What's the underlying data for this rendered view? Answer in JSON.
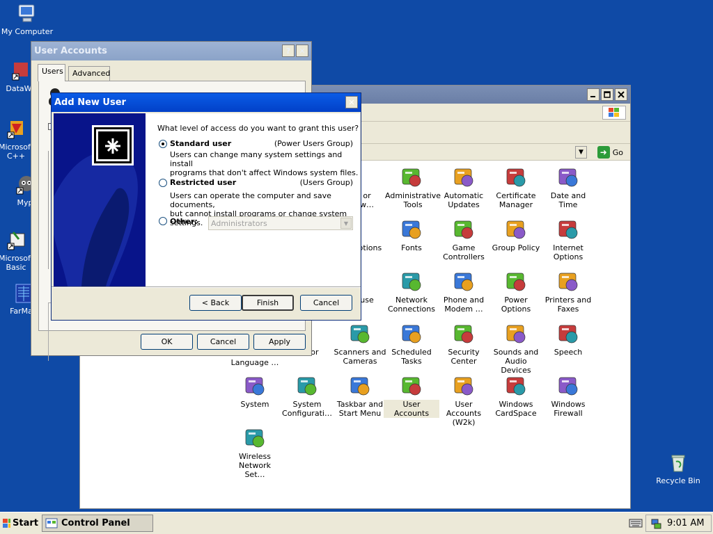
{
  "desktop": {
    "icons": [
      {
        "label": "My Computer",
        "icon": "computer-icon"
      },
      {
        "label": "DataWa",
        "icon": "datawatch-icon"
      },
      {
        "label": "Microsoft C++",
        "icon": "cpp-icon"
      },
      {
        "label": "Myp",
        "icon": "raccoon-icon"
      },
      {
        "label": "Microsoft Basic",
        "icon": "basic-icon"
      },
      {
        "label": "FarMan",
        "icon": "far-manager-icon"
      },
      {
        "label": "Recycle Bin",
        "icon": "recycle-bin-icon"
      }
    ]
  },
  "control_panel": {
    "go_label": "Go",
    "items": [
      {
        "label": "or\nw…",
        "icon": "accessibility-icon"
      },
      {
        "label": "Administrative\nTools",
        "icon": "admin-tools-icon"
      },
      {
        "label": "Automatic\nUpdates",
        "icon": "windows-update-icon"
      },
      {
        "label": "Certificate\nManager",
        "icon": "certificate-icon"
      },
      {
        "label": "Date and Time",
        "icon": "clock-icon"
      },
      {
        "label": "Options",
        "icon": "folder-options-icon"
      },
      {
        "label": "Fonts",
        "icon": "fonts-folder-icon"
      },
      {
        "label": "Game\nControllers",
        "icon": "gamepad-icon"
      },
      {
        "label": "Group Policy",
        "icon": "group-policy-icon"
      },
      {
        "label": "Internet\nOptions",
        "icon": "internet-options-icon"
      },
      {
        "label": "use",
        "icon": "mouse-icon"
      },
      {
        "label": "Network\nConnections",
        "icon": "network-icon"
      },
      {
        "label": "Phone and\nModem …",
        "icon": "phone-modem-icon"
      },
      {
        "label": "Power Options",
        "icon": "power-icon"
      },
      {
        "label": "Printers and\nFaxes",
        "icon": "printer-icon"
      },
      {
        "label": "Editor",
        "icon": "editor-icon"
      },
      {
        "label": "Language …",
        "icon": "language-icon"
      },
      {
        "label": "Scanners and\nCameras",
        "icon": "scanner-icon"
      },
      {
        "label": "Scheduled\nTasks",
        "icon": "scheduled-tasks-icon"
      },
      {
        "label": "Security\nCenter",
        "icon": "security-shield-icon"
      },
      {
        "label": "Sounds and\nAudio Devices",
        "icon": "speaker-icon"
      },
      {
        "label": "Speech",
        "icon": "speech-icon"
      },
      {
        "label": "System",
        "icon": "system-icon"
      },
      {
        "label": "System\nConfigurati…",
        "icon": "system-config-icon"
      },
      {
        "label": "Taskbar and\nStart Menu",
        "icon": "taskbar-icon"
      },
      {
        "label": "User Accounts",
        "icon": "user-accounts-icon"
      },
      {
        "label": "User Accounts\n(W2k)",
        "icon": "user-accounts-w2k-icon"
      },
      {
        "label": "Windows\nCardSpace",
        "icon": "cardspace-icon"
      },
      {
        "label": "Windows\nFirewall",
        "icon": "firewall-icon"
      },
      {
        "label": "Wireless\nNetwork Set…",
        "icon": "wireless-icon"
      }
    ]
  },
  "user_accounts_dialog": {
    "title": "User Accounts",
    "help": "?",
    "close": "✕",
    "tabs": [
      "Users",
      "Advanced"
    ],
    "buttons": {
      "ok": "OK",
      "cancel": "Cancel",
      "apply": "Apply"
    }
  },
  "add_new_user_dialog": {
    "title": "Add New User",
    "close": "✕",
    "question": "What level of access do you want to grant this user?",
    "options": [
      {
        "title": "Standard user",
        "group": "(Power Users Group)",
        "description": "Users can change many system settings and install\nprograms that don't affect Windows system files.",
        "selected": true
      },
      {
        "title": "Restricted user",
        "group": "(Users Group)",
        "description": "Users can operate the computer and save documents,\nbut cannot install programs or change system settings.",
        "selected": false
      },
      {
        "title": "Other:",
        "group": "",
        "description": "",
        "selected": false
      }
    ],
    "other_select": {
      "value": "Administrators",
      "enabled": false
    },
    "buttons": {
      "back": "< Back",
      "finish": "Finish",
      "cancel": "Cancel"
    }
  },
  "taskbar": {
    "start_label": "Start",
    "tasks": [
      {
        "label": "Control Panel",
        "icon": "control-panel-icon"
      }
    ],
    "clock": "9:01 AM"
  }
}
